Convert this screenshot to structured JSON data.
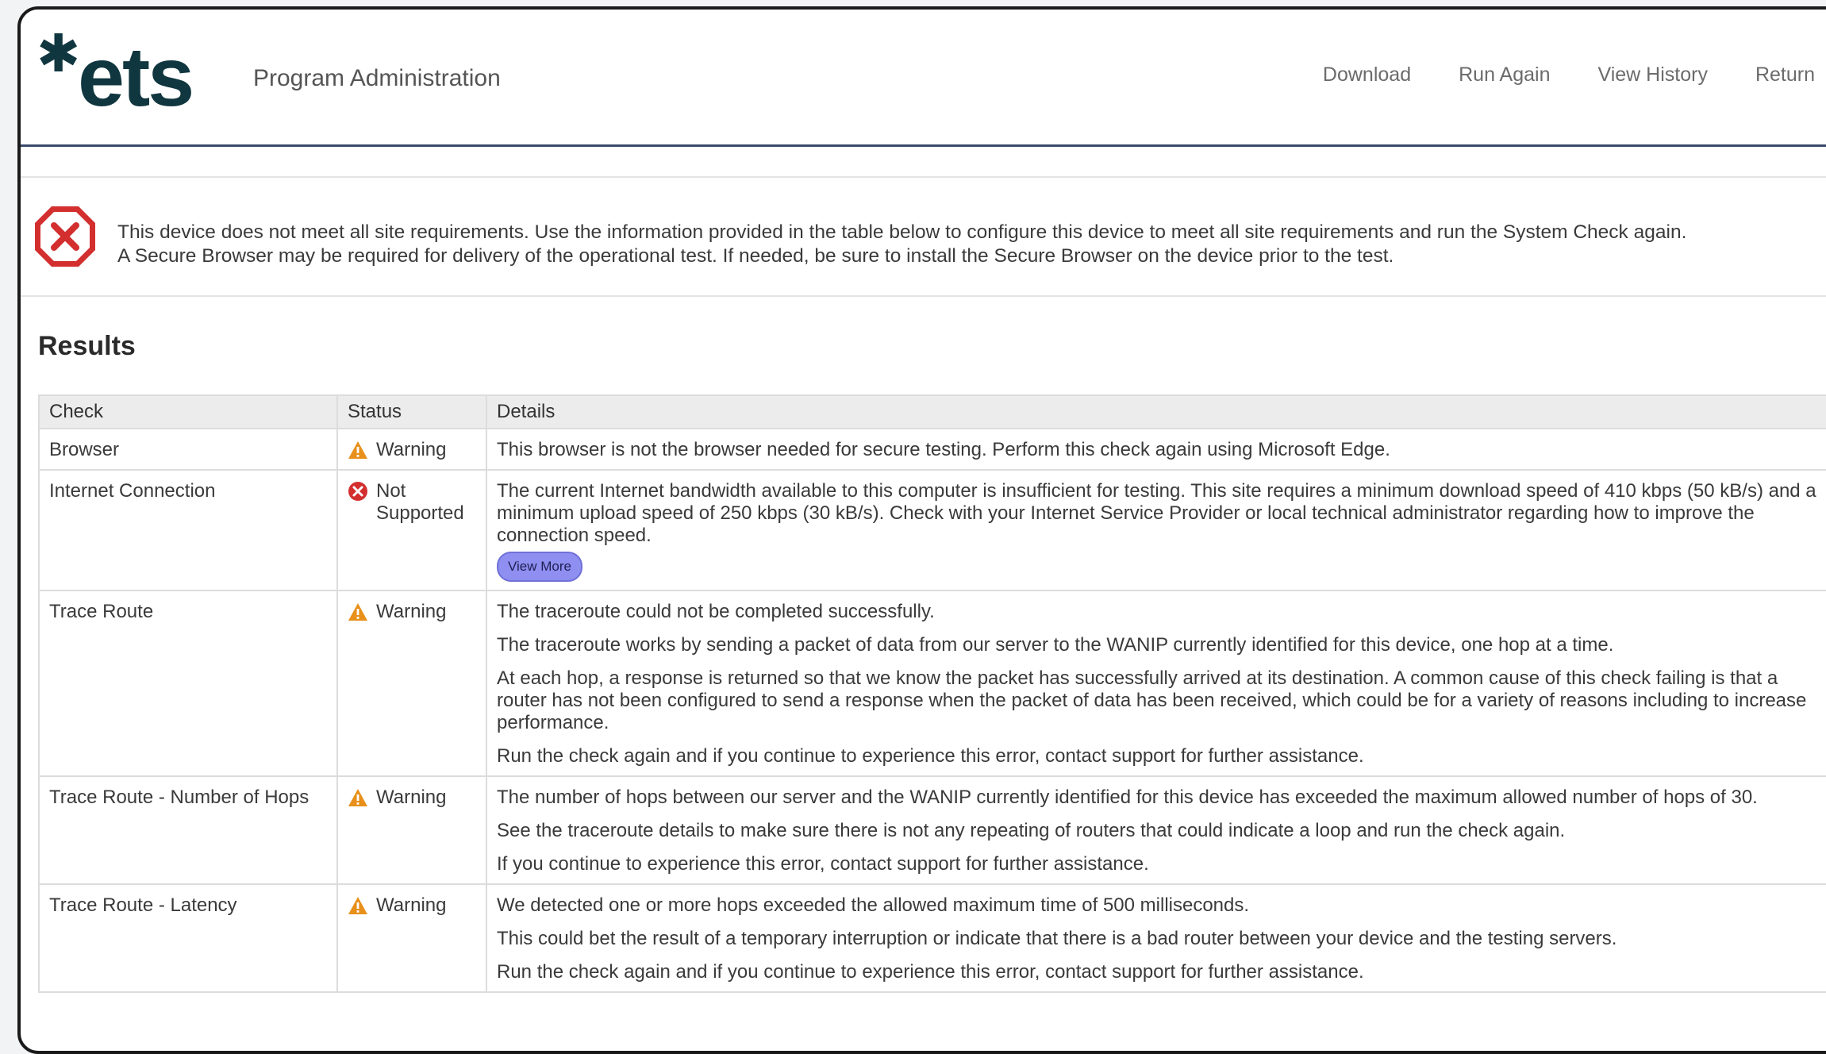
{
  "header": {
    "logo_text": "ets",
    "title": "Program Administration",
    "nav": [
      "Download",
      "Run Again",
      "View History",
      "Return"
    ]
  },
  "alert": {
    "line1": "This device does not meet all site requirements. Use the information provided in the table below to configure this device to meet all site requirements and run the System Check again.",
    "line2": "A Secure Browser may be required for delivery of the operational test. If needed, be sure to install the Secure Browser on the device prior to the test."
  },
  "results": {
    "title": "Results",
    "columns": [
      "Check",
      "Status",
      "Details"
    ],
    "rows": [
      {
        "check": "Browser",
        "status": "Warning",
        "details": [
          "This browser is not the browser needed for secure testing. Perform this check again using Microsoft Edge."
        ]
      },
      {
        "check": "Internet Connection",
        "status": "Not Supported",
        "details": [
          "The current Internet bandwidth available to this computer is insufficient for testing. This site requires a minimum download speed of 410 kbps (50 kB/s) and a minimum upload speed of 250 kbps (30 kB/s). Check with your Internet Service Provider or local technical administrator regarding how to improve the connection speed."
        ],
        "button": "View More"
      },
      {
        "check": "Trace Route",
        "status": "Warning",
        "details": [
          "The traceroute could not be completed successfully.",
          "The traceroute works by sending a packet of data from our server to the WANIP currently identified for this device, one hop at a time.",
          "At each hop, a response is returned so that we know the packet has successfully arrived at its destination. A common cause of this check failing is that a router has not been configured to send a response when the packet of data has been received, which could be for a variety of reasons including to increase performance.",
          "Run the check again and if you continue to experience this error, contact support for further assistance."
        ]
      },
      {
        "check": "Trace Route - Number of Hops",
        "status": "Warning",
        "details": [
          "The number of hops between our server and the WANIP currently identified for this device has exceeded the maximum allowed number of hops of 30.",
          "See the traceroute details to make sure there is not any repeating of routers that could indicate a loop and run the check again.",
          "If you continue to experience this error, contact support for further assistance."
        ]
      },
      {
        "check": "Trace Route - Latency",
        "status": "Warning",
        "details": [
          "We detected one or more hops exceeded the allowed maximum time of 500 milliseconds.",
          "This could bet the result of a temporary interruption or indicate that there is a bad router between your device and the testing servers.",
          "Run the check again and if you continue to experience this error, contact support for further assistance."
        ]
      }
    ]
  },
  "icons": {
    "warning": "warning-icon",
    "not_supported": "error-circle-icon",
    "alert": "error-octagon-icon"
  },
  "colors": {
    "brand": "#10363f",
    "error": "#d32f2f",
    "warning": "#e8901a",
    "button": "#8e8ff0"
  }
}
